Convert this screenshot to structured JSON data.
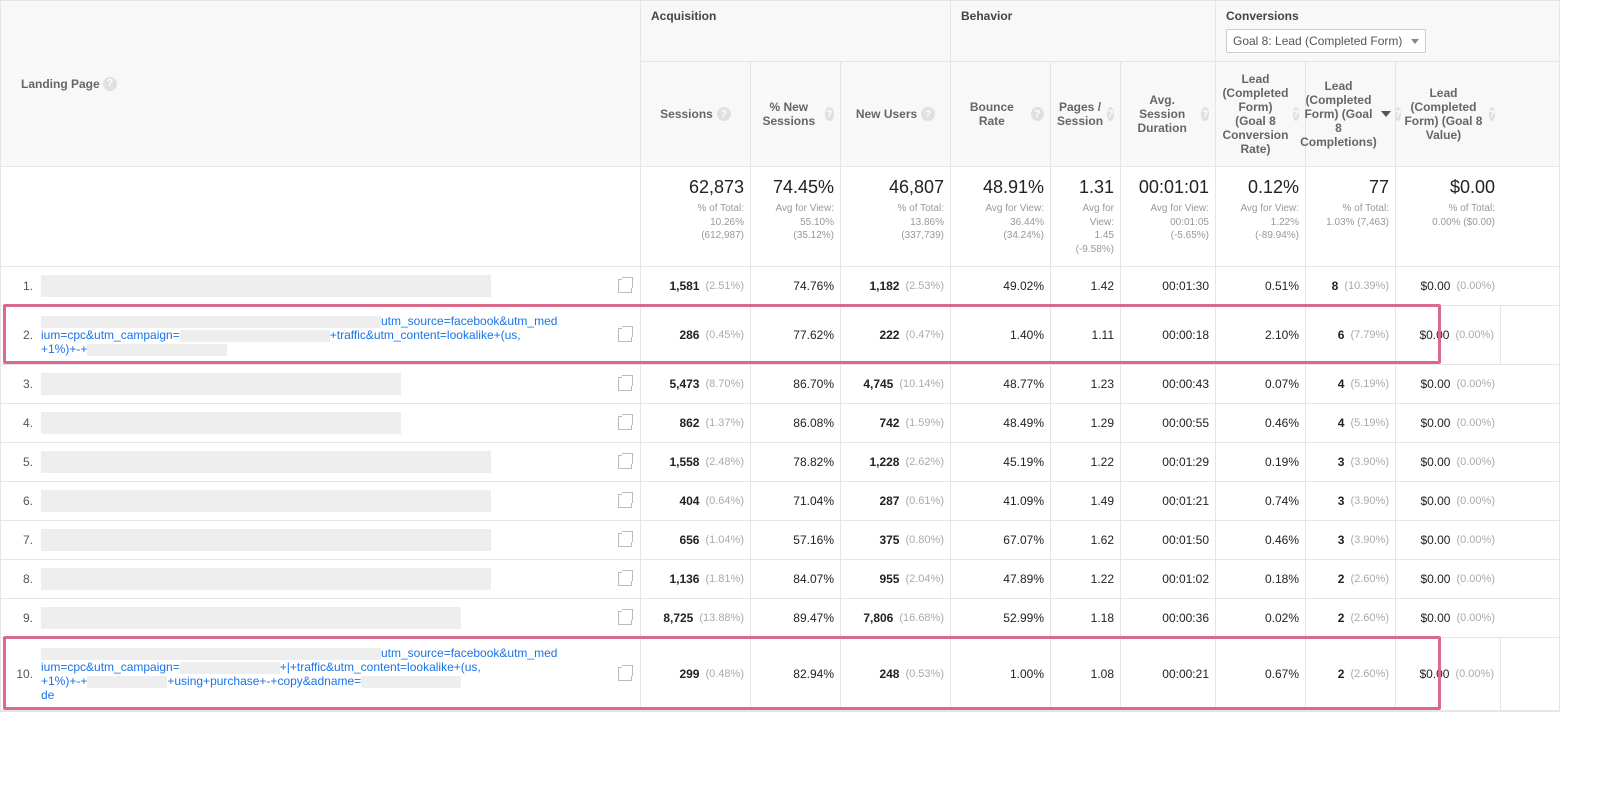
{
  "header": {
    "dim_label": "Landing Page",
    "groups": {
      "acq": "Acquisition",
      "beh": "Behavior",
      "conv": "Conversions"
    },
    "goal_selector": "Goal 8: Lead (Completed Form)",
    "cols": {
      "sessions": "Sessions",
      "new_pct": "% New Sessions",
      "new_users": "New Users",
      "bounce": "Bounce Rate",
      "pps": "Pages / Session",
      "dur": "Avg. Session Duration",
      "g_rate": "Lead (Completed Form) (Goal 8 Conversion Rate)",
      "g_comp": "Lead (Completed Form) (Goal 8 Completions)",
      "g_val": "Lead (Completed Form) (Goal 8 Value)"
    }
  },
  "summary": {
    "sessions": {
      "v": "62,873",
      "s1": "% of Total:",
      "s2": "10.26%",
      "s3": "(612,987)"
    },
    "new_pct": {
      "v": "74.45%",
      "s1": "Avg for View:",
      "s2": "55.10%",
      "s3": "(35.12%)"
    },
    "new_users": {
      "v": "46,807",
      "s1": "% of Total:",
      "s2": "13.86%",
      "s3": "(337,739)"
    },
    "bounce": {
      "v": "48.91%",
      "s1": "Avg for View:",
      "s2": "36.44%",
      "s3": "(34.24%)"
    },
    "pps": {
      "v": "1.31",
      "s1": "Avg for View:",
      "s2": "1.45",
      "s3": "(-9.58%)"
    },
    "dur": {
      "v": "00:01:01",
      "s1": "Avg for View:",
      "s2": "00:01:05",
      "s3": "(-5.65%)"
    },
    "g_rate": {
      "v": "0.12%",
      "s1": "Avg for View:",
      "s2": "1.22%",
      "s3": "(-89.94%)"
    },
    "g_comp": {
      "v": "77",
      "s1": "% of Total:",
      "s2": "1.03% (7,463)",
      "s3": ""
    },
    "g_val": {
      "v": "$0.00",
      "s1": "% of Total:",
      "s2": "0.00% ($0.00)",
      "s3": ""
    }
  },
  "rows": [
    {
      "idx": "1.",
      "lp_plain": true,
      "lp_masked": "",
      "sessions": "1,581",
      "sessions_pct": "(2.51%)",
      "new_pct": "74.76%",
      "new_users": "1,182",
      "new_users_pct": "(2.53%)",
      "bounce": "49.02%",
      "pps": "1.42",
      "dur": "00:01:30",
      "g_rate": "0.51%",
      "g_comp": "8",
      "g_comp_pct": "(10.39%)",
      "g_val": "$0.00",
      "g_val_pct": "(0.00%)"
    },
    {
      "idx": "2.",
      "lp_plain": false,
      "utm_pre": "utm_source=facebook&utm_med",
      "utm_line2a": "ium=cpc&utm_campaign=",
      "utm_line2b": "+traffic&utm_content=lookalike+(us,",
      "utm_line3": "+1%)+-+",
      "sessions": "286",
      "sessions_pct": "(0.45%)",
      "new_pct": "77.62%",
      "new_users": "222",
      "new_users_pct": "(0.47%)",
      "bounce": "1.40%",
      "pps": "1.11",
      "dur": "00:00:18",
      "g_rate": "2.10%",
      "g_comp": "6",
      "g_comp_pct": "(7.79%)",
      "g_val": "$0.00",
      "g_val_pct": "(0.00%)",
      "highlight": true
    },
    {
      "idx": "3.",
      "lp_plain": true,
      "sessions": "5,473",
      "sessions_pct": "(8.70%)",
      "new_pct": "86.70%",
      "new_users": "4,745",
      "new_users_pct": "(10.14%)",
      "bounce": "48.77%",
      "pps": "1.23",
      "dur": "00:00:43",
      "g_rate": "0.07%",
      "g_comp": "4",
      "g_comp_pct": "(5.19%)",
      "g_val": "$0.00",
      "g_val_pct": "(0.00%)"
    },
    {
      "idx": "4.",
      "lp_plain": true,
      "sessions": "862",
      "sessions_pct": "(1.37%)",
      "new_pct": "86.08%",
      "new_users": "742",
      "new_users_pct": "(1.59%)",
      "bounce": "48.49%",
      "pps": "1.29",
      "dur": "00:00:55",
      "g_rate": "0.46%",
      "g_comp": "4",
      "g_comp_pct": "(5.19%)",
      "g_val": "$0.00",
      "g_val_pct": "(0.00%)"
    },
    {
      "idx": "5.",
      "lp_plain": true,
      "sessions": "1,558",
      "sessions_pct": "(2.48%)",
      "new_pct": "78.82%",
      "new_users": "1,228",
      "new_users_pct": "(2.62%)",
      "bounce": "45.19%",
      "pps": "1.22",
      "dur": "00:01:29",
      "g_rate": "0.19%",
      "g_comp": "3",
      "g_comp_pct": "(3.90%)",
      "g_val": "$0.00",
      "g_val_pct": "(0.00%)"
    },
    {
      "idx": "6.",
      "lp_plain": true,
      "sessions": "404",
      "sessions_pct": "(0.64%)",
      "new_pct": "71.04%",
      "new_users": "287",
      "new_users_pct": "(0.61%)",
      "bounce": "41.09%",
      "pps": "1.49",
      "dur": "00:01:21",
      "g_rate": "0.74%",
      "g_comp": "3",
      "g_comp_pct": "(3.90%)",
      "g_val": "$0.00",
      "g_val_pct": "(0.00%)"
    },
    {
      "idx": "7.",
      "lp_plain": true,
      "sessions": "656",
      "sessions_pct": "(1.04%)",
      "new_pct": "57.16%",
      "new_users": "375",
      "new_users_pct": "(0.80%)",
      "bounce": "67.07%",
      "pps": "1.62",
      "dur": "00:01:50",
      "g_rate": "0.46%",
      "g_comp": "3",
      "g_comp_pct": "(3.90%)",
      "g_val": "$0.00",
      "g_val_pct": "(0.00%)"
    },
    {
      "idx": "8.",
      "lp_plain": true,
      "sessions": "1,136",
      "sessions_pct": "(1.81%)",
      "new_pct": "84.07%",
      "new_users": "955",
      "new_users_pct": "(2.04%)",
      "bounce": "47.89%",
      "pps": "1.22",
      "dur": "00:01:02",
      "g_rate": "0.18%",
      "g_comp": "2",
      "g_comp_pct": "(2.60%)",
      "g_val": "$0.00",
      "g_val_pct": "(0.00%)"
    },
    {
      "idx": "9.",
      "lp_plain": true,
      "sessions": "8,725",
      "sessions_pct": "(13.88%)",
      "new_pct": "89.47%",
      "new_users": "7,806",
      "new_users_pct": "(16.68%)",
      "bounce": "52.99%",
      "pps": "1.18",
      "dur": "00:00:36",
      "g_rate": "0.02%",
      "g_comp": "2",
      "g_comp_pct": "(2.60%)",
      "g_val": "$0.00",
      "g_val_pct": "(0.00%)"
    },
    {
      "idx": "10.",
      "lp_plain": false,
      "utm_pre": "utm_source=facebook&utm_med",
      "utm_line2a": "ium=cpc&utm_campaign=",
      "utm_line2b": "+|+traffic&utm_content=lookalike+(us,",
      "utm_line3": "+1%)+-+",
      "utm_line3b": "+using+purchase+-+copy&adname=",
      "utm_line4": "de",
      "sessions": "299",
      "sessions_pct": "(0.48%)",
      "new_pct": "82.94%",
      "new_users": "248",
      "new_users_pct": "(0.53%)",
      "bounce": "1.00%",
      "pps": "1.08",
      "dur": "00:00:21",
      "g_rate": "0.67%",
      "g_comp": "2",
      "g_comp_pct": "(2.60%)",
      "g_val": "$0.00",
      "g_val_pct": "(0.00%)",
      "highlight": true
    }
  ]
}
